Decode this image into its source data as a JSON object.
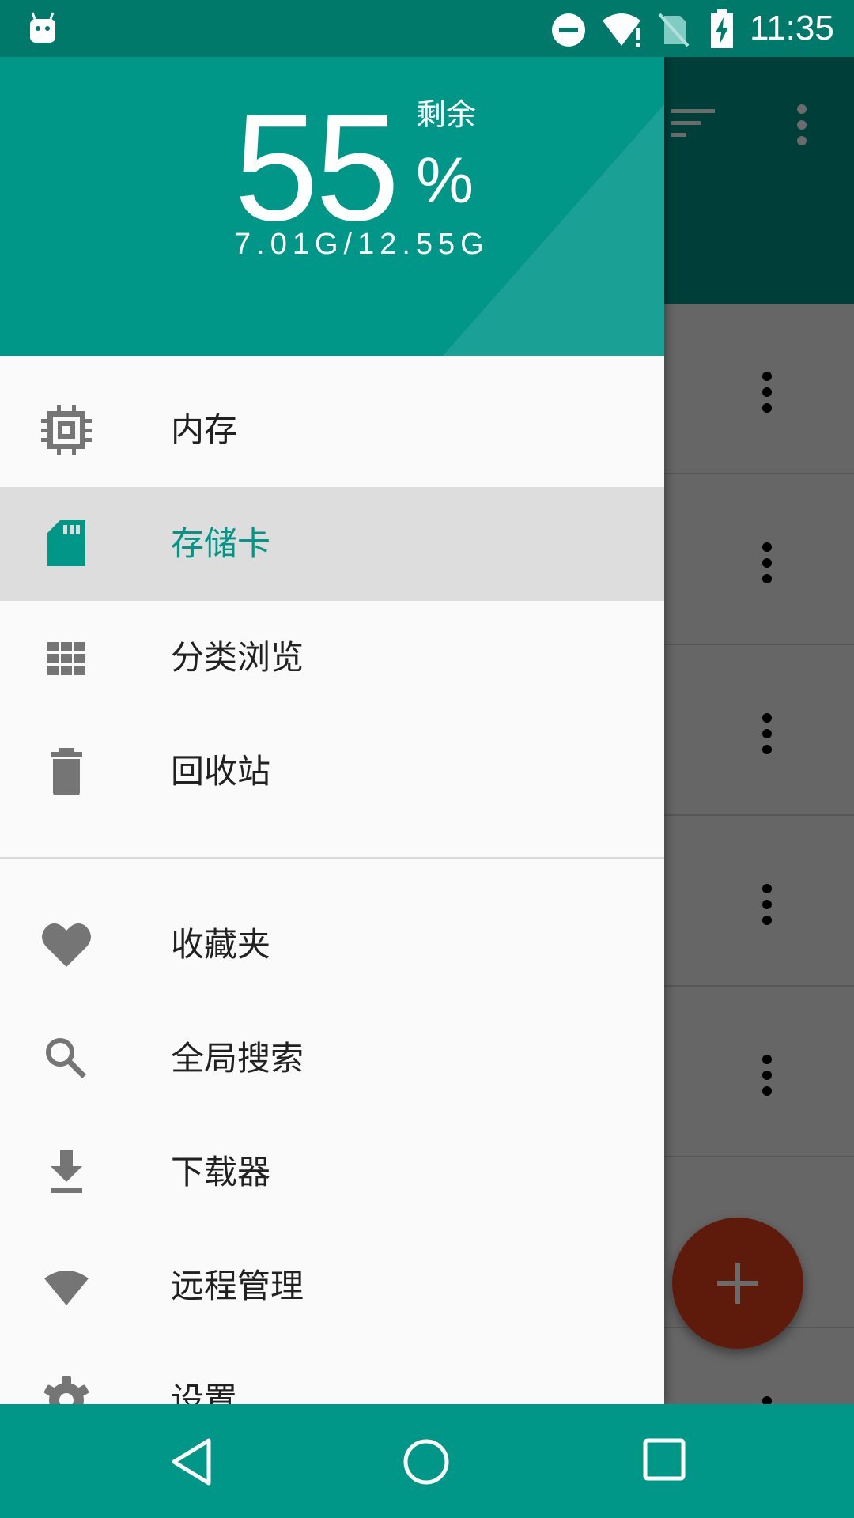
{
  "status_bar": {
    "time": "11:35",
    "icons": [
      "android-icon",
      "do-not-disturb-icon",
      "wifi-icon",
      "no-sim-icon",
      "battery-charging-icon"
    ]
  },
  "storage": {
    "percent": "55",
    "remaining_label": "剩余",
    "percent_sign": "%",
    "usage": "7.01G/12.55G"
  },
  "menu": {
    "primary": [
      {
        "label": "内存",
        "icon": "memory-chip-icon"
      },
      {
        "label": "存储卡",
        "icon": "sd-card-icon"
      },
      {
        "label": "分类浏览",
        "icon": "grid-icon"
      },
      {
        "label": "回收站",
        "icon": "trash-icon"
      }
    ],
    "secondary": [
      {
        "label": "收藏夹",
        "icon": "heart-icon"
      },
      {
        "label": "全局搜索",
        "icon": "search-icon"
      },
      {
        "label": "下载器",
        "icon": "download-icon"
      },
      {
        "label": "远程管理",
        "icon": "wifi-wedge-icon"
      },
      {
        "label": "设置",
        "icon": "settings-icon"
      }
    ]
  },
  "colors": {
    "primary": "#009688",
    "primary_dark": "#00796b",
    "accent": "#e0401e",
    "active_bg": "#dddddd"
  },
  "nav_bar": {
    "icons": [
      "back-icon",
      "home-icon",
      "recents-icon"
    ]
  }
}
